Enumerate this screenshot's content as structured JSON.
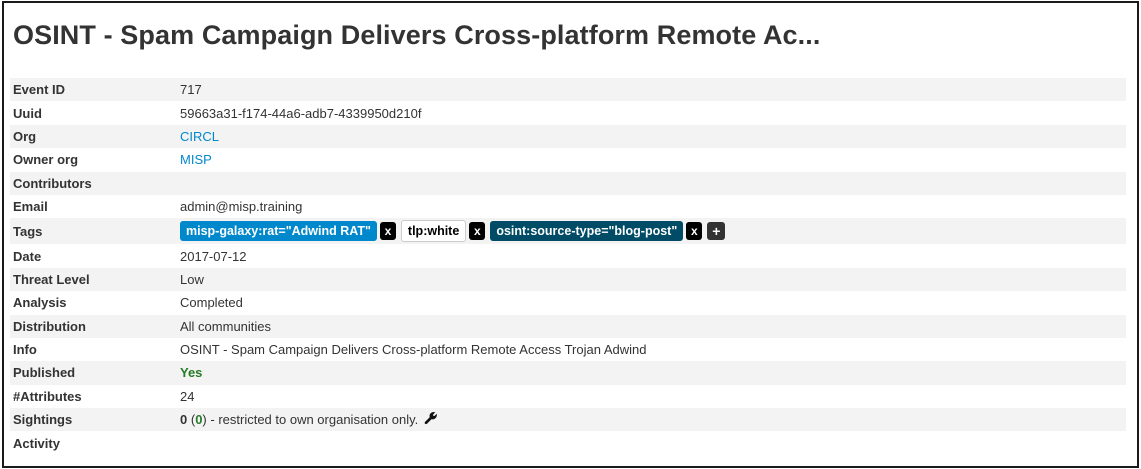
{
  "title": "OSINT - Spam Campaign Delivers Cross-platform Remote Ac...",
  "fields": {
    "event_id": {
      "label": "Event ID",
      "value": "717"
    },
    "uuid": {
      "label": "Uuid",
      "value": "59663a31-f174-44a6-adb7-4339950d210f"
    },
    "org": {
      "label": "Org",
      "value": "CIRCL"
    },
    "owner_org": {
      "label": "Owner org",
      "value": "MISP"
    },
    "contributors": {
      "label": "Contributors",
      "value": ""
    },
    "email": {
      "label": "Email",
      "value": "admin@misp.training"
    },
    "tags": {
      "label": "Tags"
    },
    "date": {
      "label": "Date",
      "value": "2017-07-12"
    },
    "threat_level": {
      "label": "Threat Level",
      "value": "Low"
    },
    "analysis": {
      "label": "Analysis",
      "value": "Completed"
    },
    "distribution": {
      "label": "Distribution",
      "value": "All communities"
    },
    "info": {
      "label": "Info",
      "value": "OSINT - Spam Campaign Delivers Cross-platform Remote Access Trojan Adwind"
    },
    "published": {
      "label": "Published",
      "value": "Yes"
    },
    "attributes": {
      "label": "#Attributes",
      "value": "24"
    },
    "sightings": {
      "label": "Sightings",
      "count": "0",
      "own": "0",
      "note": "- restricted to own organisation only."
    },
    "activity": {
      "label": "Activity",
      "value": ""
    }
  },
  "tags": [
    {
      "text": "misp-galaxy:rat=\"Adwind RAT\"",
      "color": "#0088cc"
    },
    {
      "text": "tlp:white",
      "color": "#ffffff"
    },
    {
      "text": "osint:source-type=\"blog-post\"",
      "color": "#004b66"
    }
  ],
  "tag_remove_label": "x",
  "tag_add_label": "+",
  "icons": {
    "sightings_action": "wrench-icon"
  }
}
